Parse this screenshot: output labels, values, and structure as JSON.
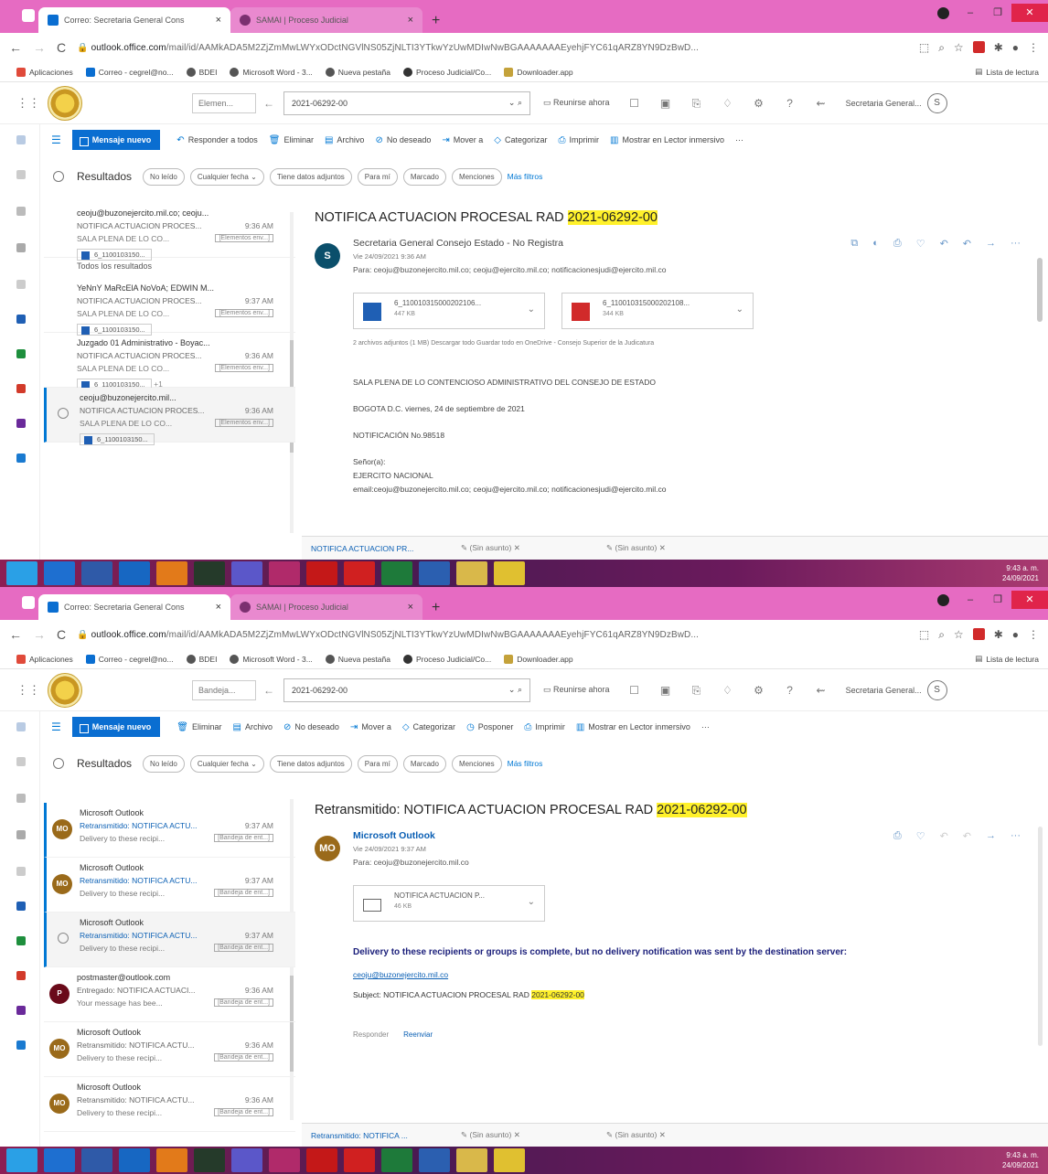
{
  "browser": {
    "tabs": [
      {
        "title": "Correo: Secretaria General Cons",
        "close": "×"
      },
      {
        "title": "SAMAI | Proceso Judicial",
        "close": "×"
      }
    ],
    "new_tab": "+",
    "url_host": "outlook.office.com",
    "url_path": "/mail/id/AAMkADA5M2ZjZmMwLWYxODctNGVlNS05ZjNLTI3YTkwYzUwMDIwNwBGAAAAAAAEyehjFYC61qARZ8YN9DzBwD...",
    "bookmarks": [
      "Aplicaciones",
      "Correo - cegrel@no...",
      "BDEI",
      "Microsoft Word - 3...",
      "Nueva pestaña",
      "Proceso Judicial/Co...",
      "Downloader.app"
    ],
    "reading_list": "Lista de lectura"
  },
  "outlook": {
    "search_text": "2021-06292-00",
    "meet_now": "Reunirse ahora",
    "account": "Secretaria General...",
    "account_initial": "S",
    "filter": {
      "results_label": "Resultados",
      "pills": [
        "No leído",
        "Cualquier fecha ⌄",
        "Tiene datos adjuntos",
        "Para mí",
        "Marcado",
        "Menciones"
      ],
      "more": "Más filtros"
    }
  },
  "shot1": {
    "scope": "Elemen...",
    "commands": [
      "Mensaje nuevo",
      "Responder a todos",
      "Eliminar",
      "Archivo",
      "No deseado",
      "Mover a",
      "Categorizar",
      "Imprimir",
      "Mostrar en Lector inmersivo",
      "···"
    ],
    "section_all": "Todos los resultados",
    "list": [
      {
        "from": "ceoju@buzonejercito.mil.co; ceoju...",
        "subject": "NOTIFICA ACTUACION PROCES...",
        "time": "9:36 AM",
        "preview": "SALA PLENA DE LO CO...",
        "category": "[Elementos env...]",
        "attachment": "6_1100103150..."
      },
      {
        "from": "YeNnY MaRcElA NoVoA; EDWIN M...",
        "subject": "NOTIFICA ACTUACION PROCES...",
        "time": "9:37 AM",
        "preview": "SALA PLENA DE LO CO...",
        "category": "[Elementos env...]",
        "attachment": "6_1100103150..."
      },
      {
        "from": "Juzgado 01 Administrativo - Boyac...",
        "subject": "NOTIFICA ACTUACION PROCES...",
        "time": "9:36 AM",
        "preview": "SALA PLENA DE LO CO...",
        "category": "[Elementos env...]",
        "attachment": "6_1100103150...",
        "extra": "+1"
      },
      {
        "from": "ceoju@buzonejercito.mil...",
        "subject": "NOTIFICA ACTUACION PROCES...",
        "time": "9:36 AM",
        "preview": "SALA PLENA DE LO CO...",
        "category": "[Elementos env...]",
        "attachment": "6_1100103150..."
      }
    ],
    "message": {
      "subject_prefix": "NOTIFICA ACTUACION PROCESAL RAD ",
      "subject_highlight": "2021-06292-00",
      "sender": "Secretaria General Consejo Estado - No Registra",
      "avatar": "S",
      "date": "Vie 24/09/2021 9:36 AM",
      "to": "Para: ceoju@buzonejercito.mil.co; ceoju@ejercito.mil.co; notificacionesjudi@ejercito.mil.co",
      "attachments": [
        {
          "name": "6_11001031500020210​6...",
          "size": "447 KB"
        },
        {
          "name": "6_11001031500020210​8...",
          "size": "344 KB"
        }
      ],
      "att_meta": "2 archivos adjuntos (1 MB)   Descargar todo   Guardar todo en OneDrive - Consejo Superior de la Judicatura",
      "body": [
        "SALA PLENA DE LO CONTENCIOSO ADMINISTRATIVO DEL CONSEJO DE ESTADO",
        "BOGOTA D.C. viernes, 24 de septiembre de 2021",
        "NOTIFICACIÓN No.98518",
        "Señor(a):",
        "EJERCITO NACIONAL",
        "email:ceoju@buzonejercito.mil.co; ceoju@ejercito.mil.co; notificacionesjudi@ejercito.mil.co"
      ]
    },
    "drafts": [
      "NOTIFICA ACTUACION PR...",
      "(Sin asunto)",
      "(Sin asunto)"
    ],
    "clock": [
      "9:43 a. m.",
      "24/09/2021"
    ]
  },
  "shot2": {
    "scope": "Bandeja...",
    "commands": [
      "Mensaje nuevo",
      "Eliminar",
      "Archivo",
      "No deseado",
      "Mover a",
      "Categorizar",
      "Posponer",
      "Imprimir",
      "Mostrar en Lector inmersivo",
      "···"
    ],
    "list": [
      {
        "from": "Microsoft Outlook",
        "subject": "Retransmitido: NOTIFICA ACTU...",
        "time": "9:37 AM",
        "preview": "Delivery to these recipi...",
        "category": "[Bandeja de ent...]",
        "avatar": "MO"
      },
      {
        "from": "Microsoft Outlook",
        "subject": "Retransmitido: NOTIFICA ACTU...",
        "time": "9:37 AM",
        "preview": "Delivery to these recipi...",
        "category": "[Bandeja de ent...]",
        "avatar": "MO"
      },
      {
        "from": "Microsoft Outlook",
        "subject": "Retransmitido: NOTIFICA ACTU...",
        "time": "9:37 AM",
        "preview": "Delivery to these recipi...",
        "category": "[Bandeja de ent...]",
        "avatar": ""
      },
      {
        "from": "postmaster@outlook.com",
        "subject": "Entregado: NOTIFICA ACTUACI...",
        "time": "9:36 AM",
        "preview": "Your message has bee...",
        "category": "[Bandeja de ent...]",
        "avatar": "P"
      },
      {
        "from": "Microsoft Outlook",
        "subject": "Retransmitido: NOTIFICA ACTU...",
        "time": "9:36 AM",
        "preview": "Delivery to these recipi...",
        "category": "[Bandeja de ent...]",
        "avatar": "MO"
      },
      {
        "from": "Microsoft Outlook",
        "subject": "Retransmitido: NOTIFICA ACTU...",
        "time": "9:36 AM",
        "preview": "Delivery to these recipi...",
        "category": "[Bandeja de ent...]",
        "avatar": "MO"
      }
    ],
    "message": {
      "subject_prefix": "Retransmitido: NOTIFICA ACTUACION PROCESAL RAD ",
      "subject_highlight": "2021-06292-00",
      "sender": "Microsoft Outlook",
      "avatar": "MO",
      "date": "Vie 24/09/2021 9:37 AM",
      "to": "Para: ceoju@buzonejercito.mil.co",
      "attachment": {
        "name": "NOTIFICA ACTUACION P...",
        "size": "46 KB"
      },
      "ndr": "Delivery to these recipients or groups is complete, but no delivery notification was sent by the destination server:",
      "ndr_recipient": "ceoju@buzonejercito.mil.co",
      "ndr_subject_prefix": "Subject: NOTIFICA ACTUACION PROCESAL RAD ",
      "ndr_subject_highlight": "2021-06292-00",
      "reply": "Responder",
      "forward": "Reenviar"
    },
    "drafts": [
      "Retransmitido: NOTIFICA ...",
      "(Sin asunto)",
      "(Sin asunto)"
    ],
    "clock": [
      "9:43 a. m.",
      "24/09/2021"
    ]
  },
  "colors": {
    "accent": "#0078d4",
    "tabbar": "#e66bc2",
    "highlight": "#fff12b",
    "close": "#e0244a"
  }
}
